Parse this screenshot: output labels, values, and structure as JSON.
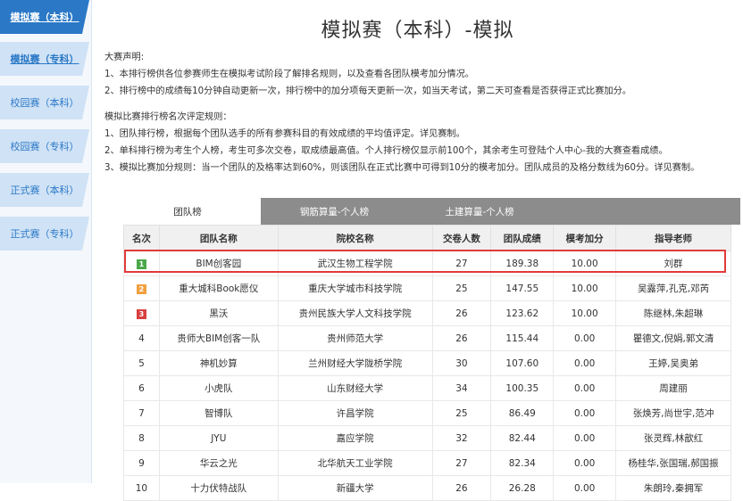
{
  "sidebar": {
    "items": [
      {
        "label": "模拟赛（本科）",
        "state": "active"
      },
      {
        "label": "模拟赛（专科）",
        "state": "selected"
      },
      {
        "label": "校园赛（本科）",
        "state": "normal"
      },
      {
        "label": "校园赛（专科）",
        "state": "normal"
      },
      {
        "label": "正式赛（本科）",
        "state": "normal"
      },
      {
        "label": "正式赛（专科）",
        "state": "normal"
      }
    ]
  },
  "page": {
    "title": "模拟赛（本科）-模拟"
  },
  "notes": {
    "heading1": "大赛声明:",
    "line1": "1、本排行榜供各位参赛师生在模拟考试阶段了解排名规则，以及查看各团队模考加分情况。",
    "line2": "2、排行榜中的成绩每10分钟自动更新一次，排行榜中的加分项每天更新一次，如当天考试，第二天可查看是否获得正式比赛加分。",
    "heading2": "模拟比赛排行榜名次评定规则：",
    "line3": "1、团队排行榜，根据每个团队选手的所有参赛科目的有效成绩的平均值评定。详见赛制。",
    "line4": "2、单科排行榜为考生个人榜，考生可多次交卷，取成绩最高值。个人排行榜仅显示前100个，其余考生可登陆个人中心-我的大赛查看成绩。",
    "line5": "3、模拟比赛加分规则：当一个团队的及格率达到60%，则该团队在正式比赛中可得到10分的模考加分。团队成员的及格分数线为60分。详见赛制。"
  },
  "tabs": [
    {
      "label": "团队榜"
    },
    {
      "label": "钢筋算量-个人榜"
    },
    {
      "label": "土建算量-个人榜"
    }
  ],
  "table": {
    "headers": [
      "名次",
      "团队名称",
      "院校名称",
      "交卷人数",
      "团队成绩",
      "模考加分",
      "指导老师"
    ],
    "rows": [
      {
        "rank": "1",
        "team": "BIM创客园",
        "school": "武汉生物工程学院",
        "count": "27",
        "score": "189.38",
        "bonus": "10.00",
        "teacher": "刘群"
      },
      {
        "rank": "2",
        "team": "重大城科Book愿仪",
        "school": "重庆大学城市科技学院",
        "count": "25",
        "score": "147.55",
        "bonus": "10.00",
        "teacher": "吴露萍,孔克,邓芮"
      },
      {
        "rank": "3",
        "team": "黑沃",
        "school": "贵州民族大学人文科技学院",
        "count": "26",
        "score": "123.62",
        "bonus": "10.00",
        "teacher": "陈继林,朱超琳"
      },
      {
        "rank": "4",
        "team": "贵师大BIM创客一队",
        "school": "贵州师范大学",
        "count": "26",
        "score": "115.44",
        "bonus": "0.00",
        "teacher": "瞿德文,倪娟,郭文清"
      },
      {
        "rank": "5",
        "team": "神机妙算",
        "school": "兰州财经大学陇桥学院",
        "count": "30",
        "score": "107.60",
        "bonus": "0.00",
        "teacher": "王婷,吴奥弟"
      },
      {
        "rank": "6",
        "team": "小虎队",
        "school": "山东财经大学",
        "count": "34",
        "score": "100.35",
        "bonus": "0.00",
        "teacher": "周建丽"
      },
      {
        "rank": "7",
        "team": "智博队",
        "school": "许昌学院",
        "count": "25",
        "score": "86.49",
        "bonus": "0.00",
        "teacher": "张焕芳,尚世宇,范冲"
      },
      {
        "rank": "8",
        "team": "JYU",
        "school": "嘉应学院",
        "count": "32",
        "score": "82.44",
        "bonus": "0.00",
        "teacher": "张灵辉,林歆红"
      },
      {
        "rank": "9",
        "team": "华云之光",
        "school": "北华航天工业学院",
        "count": "27",
        "score": "82.34",
        "bonus": "0.00",
        "teacher": "杨桂华,张国瑞,郝国振"
      },
      {
        "rank": "10",
        "team": "十力伏特战队",
        "school": "新疆大学",
        "count": "26",
        "score": "26.28",
        "bonus": "0.00",
        "teacher": "朱朗玲,秦拥军"
      }
    ]
  },
  "colors": {
    "sidebar_active": "#2a78c6",
    "sidebar_tab": "#cfe2f6",
    "rank1": "#4aa84a",
    "rank2": "#f0a040",
    "rank3": "#d84040",
    "highlight": "#e03a3a",
    "tab_bar": "#8c8c8c"
  }
}
